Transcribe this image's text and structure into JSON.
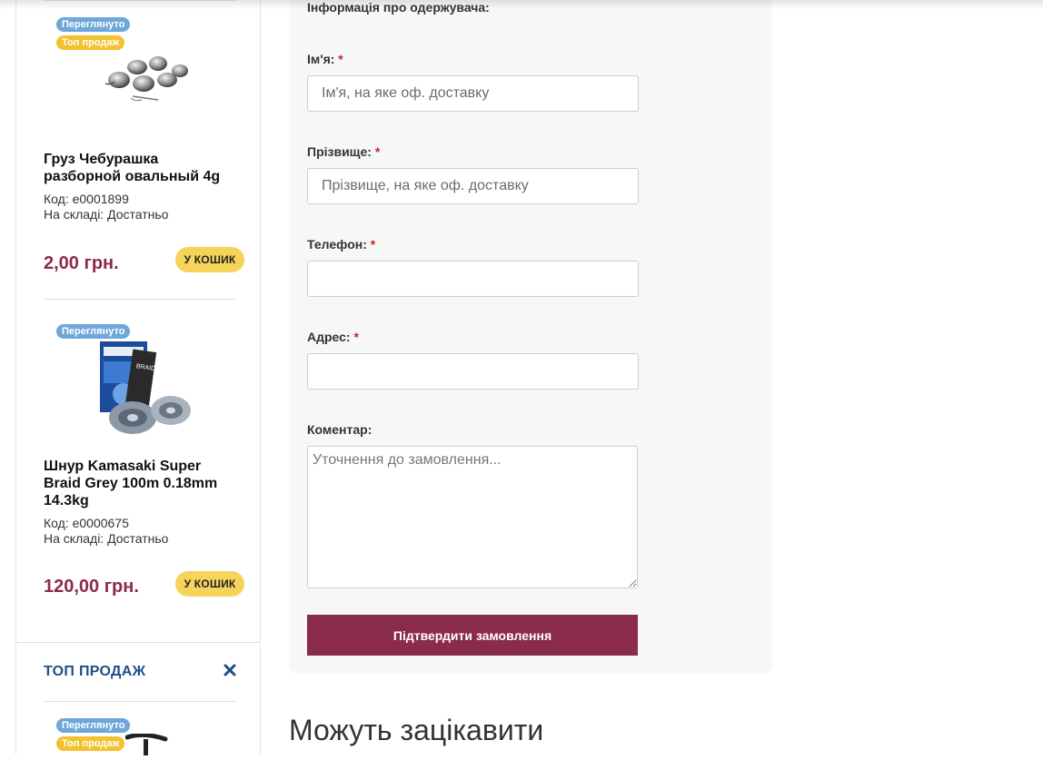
{
  "sidebar": {
    "products": [
      {
        "badges": [
          "Переглянуто",
          "Топ продаж"
        ],
        "image": "lead-sinker-weights",
        "name": "Груз Чебурашка разборной овальный 4g",
        "code": "Код: e0001899",
        "stock": "На складі: Достатньо",
        "price": "2,00 грн.",
        "cart_label": "У КОШИК"
      },
      {
        "badges": [
          "Переглянуто"
        ],
        "image": "braided-line-spool",
        "name": "Шнур Kamasaki Super Braid Grey 100m 0.18mm 14.3kg",
        "code": "Код: e0000675",
        "stock": "На складі: Достатньо",
        "price": "120,00 грн.",
        "cart_label": "У КОШИК"
      }
    ],
    "top_section": {
      "title": "ТОП ПРОДАЖ",
      "close_icon": "close-icon",
      "badges": [
        "Переглянуто",
        "Топ продаж"
      ]
    }
  },
  "form": {
    "heading": "Інформація про одержувача:",
    "required_mark": "*",
    "fields": {
      "first_name": {
        "label": "Ім'я:",
        "placeholder": "Ім'я, на яке оф. доставку",
        "value": ""
      },
      "last_name": {
        "label": "Прізвище:",
        "placeholder": "Прізвище, на яке оф. доставку",
        "value": ""
      },
      "phone": {
        "label": "Телефон:",
        "placeholder": "",
        "value": ""
      },
      "address": {
        "label": "Адрес:",
        "placeholder": "",
        "value": ""
      },
      "comment": {
        "label": "Коментар:",
        "placeholder": "Уточнення до замовлення...",
        "value": ""
      }
    },
    "submit_label": "Підтвердити замовлення"
  },
  "recommend": {
    "title": "Можуть зацікавити"
  },
  "colors": {
    "accent": "#8b2b4a",
    "price": "#8b2b4a",
    "cart_button": "#f6d35a",
    "badge_viewed": "#6ea7d8",
    "badge_top": "#f2c230",
    "sidebar_title": "#1f4f86",
    "required": "#c62828"
  }
}
